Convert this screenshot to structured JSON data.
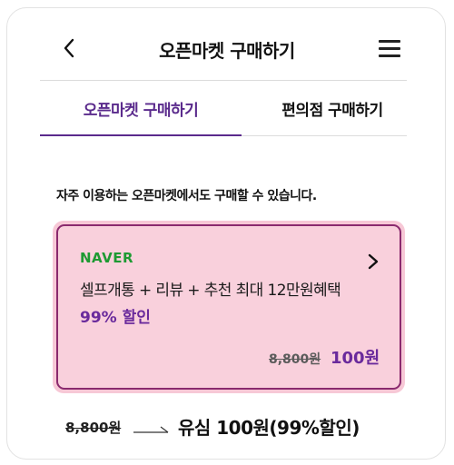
{
  "header": {
    "title": "오픈마켓 구매하기",
    "back_icon": "chevron-left-icon",
    "menu_icon": "hamburger-menu-icon"
  },
  "tabs": [
    {
      "label": "오픈마켓 구매하기",
      "active": true
    },
    {
      "label": "편의점 구매하기",
      "active": false
    }
  ],
  "description": "자주 이용하는 오픈마켓에서도 구매할 수 있습니다.",
  "offer_card": {
    "brand": "NAVER",
    "line1": "셀프개통 + 리뷰 + 추천 최대 12만원혜택",
    "line2": "99% 할인",
    "original_price": "8,800원",
    "sale_price": "100원",
    "chevron_icon": "chevron-right-icon"
  },
  "bottom_price": {
    "original_price": "8,800원",
    "arrow_icon": "arrow-right-icon",
    "summary": "유심 100원(99%할인)"
  },
  "colors": {
    "accent_purple": "#5a2a8c",
    "card_bg": "#f9d0dc",
    "card_border": "#8a2a6e",
    "naver_green": "#1e9a33"
  }
}
